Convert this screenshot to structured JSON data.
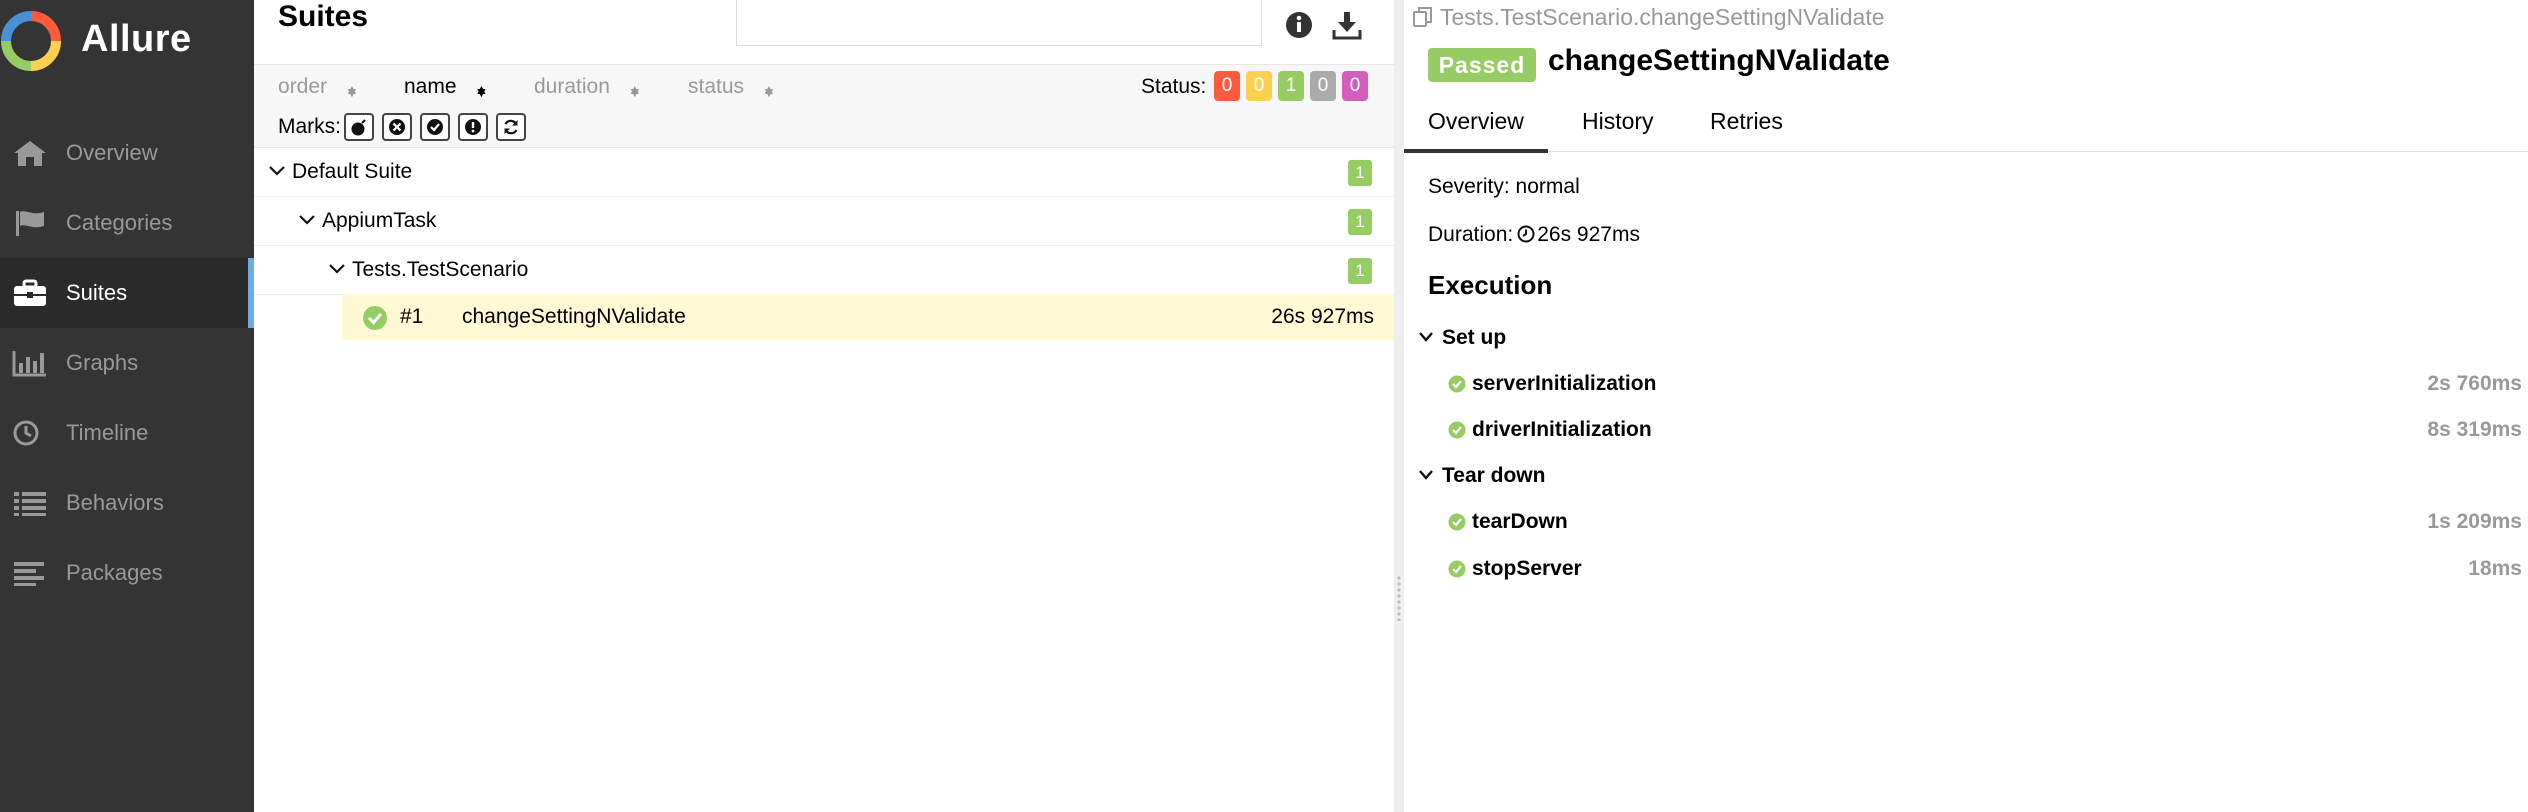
{
  "app": {
    "brand": "Allure"
  },
  "sidebar": {
    "items": [
      {
        "label": "Overview",
        "icon": "home-icon"
      },
      {
        "label": "Categories",
        "icon": "flag-icon"
      },
      {
        "label": "Suites",
        "icon": "briefcase-icon",
        "active": true
      },
      {
        "label": "Graphs",
        "icon": "bar-chart-icon"
      },
      {
        "label": "Timeline",
        "icon": "clock-icon"
      },
      {
        "label": "Behaviors",
        "icon": "list-icon"
      },
      {
        "label": "Packages",
        "icon": "align-left-icon"
      }
    ]
  },
  "suites": {
    "title": "Suites",
    "sort": {
      "order": "order",
      "name": "name",
      "duration": "duration",
      "status": "status",
      "active": "name"
    },
    "status_label": "Status:",
    "status_counts": [
      {
        "value": "0",
        "color": "#fd5a3e"
      },
      {
        "value": "0",
        "color": "#ffd050"
      },
      {
        "value": "1",
        "color": "#97cc64"
      },
      {
        "value": "0",
        "color": "#aaaaaa"
      },
      {
        "value": "0",
        "color": "#d35ebe"
      }
    ],
    "marks_label": "Marks:",
    "marks": [
      "bomb-icon",
      "times-circle-icon",
      "check-circle-icon",
      "exclamation-circle-icon",
      "refresh-icon"
    ],
    "tree": [
      {
        "label": "Default Suite",
        "count": "1"
      },
      {
        "label": "AppiumTask",
        "count": "1"
      },
      {
        "label": "Tests.TestScenario",
        "count": "1"
      }
    ],
    "selected_test": {
      "number": "#1",
      "name": "changeSettingNValidate",
      "duration": "26s 927ms"
    }
  },
  "detail": {
    "breadcrumb": "Tests.TestScenario.changeSettingNValidate",
    "status": "Passed",
    "title": "changeSettingNValidate",
    "tabs": [
      "Overview",
      "History",
      "Retries"
    ],
    "active_tab": "Overview",
    "severity_label": "Severity:",
    "severity": "normal",
    "duration_label": "Duration:",
    "duration": "26s 927ms",
    "execution_title": "Execution",
    "setup": {
      "label": "Set up",
      "steps": [
        {
          "name": "serverInitialization",
          "duration": "2s 760ms"
        },
        {
          "name": "driverInitialization",
          "duration": "8s 319ms"
        }
      ]
    },
    "teardown": {
      "label": "Tear down",
      "steps": [
        {
          "name": "tearDown",
          "duration": "1s 209ms"
        },
        {
          "name": "stopServer",
          "duration": "18ms"
        }
      ]
    }
  },
  "colors": {
    "passed": "#97cc64",
    "sidebar": "#343434",
    "active_marker": "#6bace8",
    "selected_row": "#fff9d4"
  }
}
